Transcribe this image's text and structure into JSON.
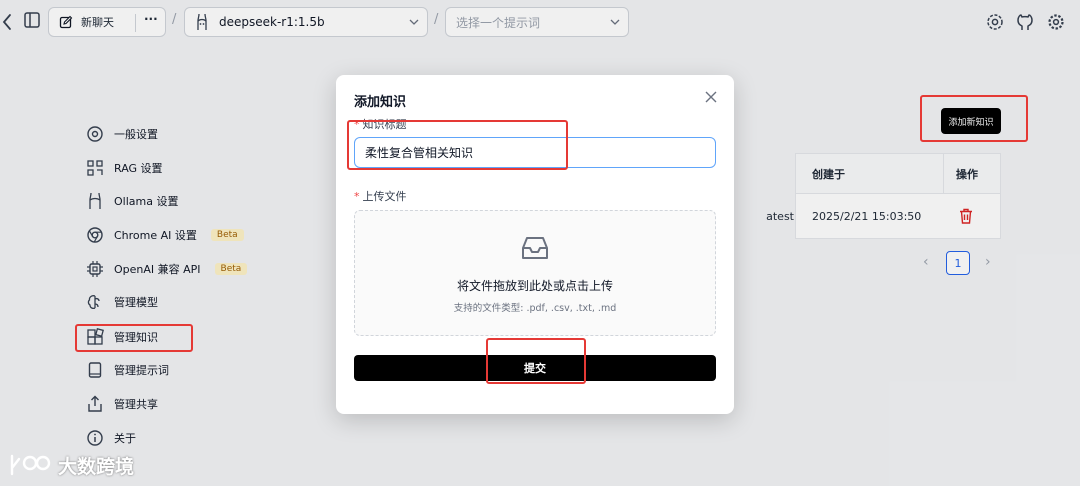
{
  "topbar": {
    "new_chat_label": "新聊天",
    "more_label": "···",
    "separator": "/",
    "model_name": "deepseek-r1:1.5b",
    "prompt_placeholder": "选择一个提示词"
  },
  "sidebar": {
    "items": [
      {
        "label": "一般设置",
        "icon": "gear-circle-icon"
      },
      {
        "label": "RAG 设置",
        "icon": "scan-icon"
      },
      {
        "label": "Ollama 设置",
        "icon": "llama-icon"
      },
      {
        "label": "Chrome AI 设置",
        "icon": "chrome-icon",
        "badge": "Beta"
      },
      {
        "label": "OpenAI 兼容 API",
        "icon": "chip-icon",
        "badge": "Beta"
      },
      {
        "label": "管理模型",
        "icon": "brain-icon"
      },
      {
        "label": "管理知识",
        "icon": "blocks-icon"
      },
      {
        "label": "管理提示词",
        "icon": "book-icon"
      },
      {
        "label": "管理共享",
        "icon": "share-icon"
      },
      {
        "label": "关于",
        "icon": "info-icon"
      }
    ]
  },
  "knowledge_page": {
    "add_button_label": "添加新知识",
    "table": {
      "headers": {
        "created": "创建于",
        "actions": "操作"
      },
      "rows": [
        {
          "name_suffix": "atest",
          "created": "2025/2/21 15:03:50"
        }
      ]
    },
    "pagination": {
      "prev": "‹",
      "current": "1",
      "next": "›"
    }
  },
  "modal": {
    "title": "添加知识",
    "close_label": "×",
    "title_field": {
      "required_mark": "*",
      "label": "知识标题",
      "value": "柔性复合管相关知识"
    },
    "file_field": {
      "required_mark": "*",
      "label": "上传文件"
    },
    "dropzone": {
      "main_text": "将文件拖放到此处或点击上传",
      "sub_text": "支持的文件类型: .pdf, .csv, .txt, .md"
    },
    "submit_label": "提交"
  },
  "watermark": {
    "text": "大数跨境"
  },
  "colors": {
    "annotation": "#e53935",
    "primary_button": "#000000",
    "input_focus": "#60a5fa"
  }
}
